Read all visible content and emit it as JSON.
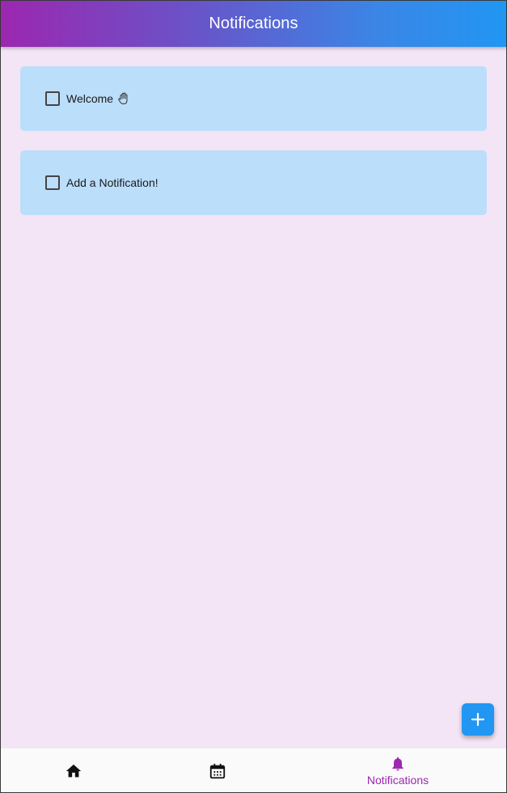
{
  "app_bar": {
    "title": "Notifications",
    "gradient": [
      "#9c27b0",
      "#2196f3"
    ]
  },
  "notifications": [
    {
      "label": "Welcome",
      "checked": false,
      "emoji": "waving-hand-icon"
    },
    {
      "label": "Add a Notification!",
      "checked": false
    }
  ],
  "fab": {
    "icon": "plus-icon",
    "color": "#2196f3"
  },
  "bottom_nav": {
    "items": [
      {
        "icon": "home-icon",
        "label": ""
      },
      {
        "icon": "calendar-icon",
        "label": ""
      },
      {
        "icon": "bell-icon",
        "label": "Notifications",
        "selected": true
      }
    ],
    "active_color": "#9c27b0"
  },
  "colors": {
    "background": "#f3e5f5",
    "card": "#bbdefb"
  }
}
